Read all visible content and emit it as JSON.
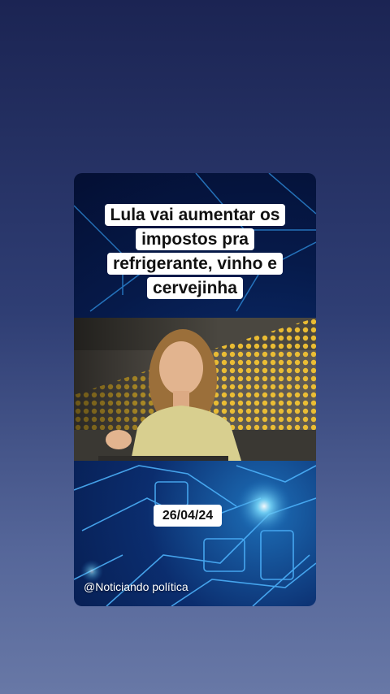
{
  "post": {
    "headline_lines": [
      "Lula vai aumentar os",
      "impostos pra",
      "refrigerante, vinho e",
      "cervejinha"
    ],
    "date": "26/04/24",
    "handle": "@Noticiando política"
  },
  "colors": {
    "background_top": "#1b2453",
    "background_bottom": "#6878a6",
    "card_dark": "#061a4a",
    "card_glow": "#1d6fb8",
    "dots": "#f2c232",
    "label_bg": "#ffffff"
  }
}
